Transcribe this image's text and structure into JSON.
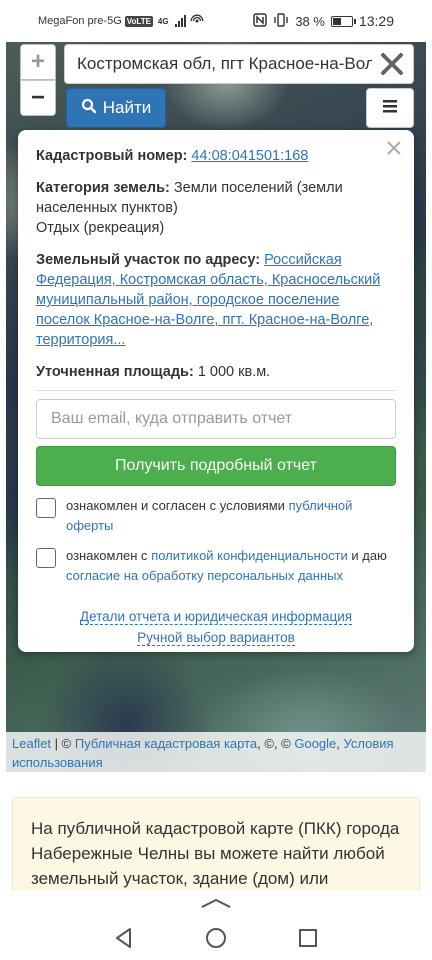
{
  "status_bar": {
    "carrier": "MegaFon pre-5G",
    "network_badge": "VoLTE",
    "network_type": "4G",
    "nfc_icon": "nfc-icon",
    "battery_percent": "38 %",
    "battery_level": 0.38,
    "time": "13:29"
  },
  "map": {
    "zoom_in_label": "+",
    "zoom_out_label": "−",
    "search": {
      "value": "Костромская обл, пгт Красное-на-Волге",
      "placeholder": ""
    },
    "find_button_label": "Найти",
    "attribution": {
      "leaflet": "Leaflet",
      "sep1": " | © ",
      "pkk": "Публичная кадастровая карта",
      "sep2": ", ©, © ",
      "google": "Google",
      "sep3": ", ",
      "terms": "Условия использования"
    }
  },
  "popup": {
    "cadastral_label": "Кадастровый номер:",
    "cadastral_number": "44:08:041501:168",
    "category_label": "Категория земель:",
    "category_value": "Земли поселений (земли населенных пунктов)",
    "usage_value": "Отдых (рекреация)",
    "address_label": "Земельный участок по адресу:",
    "address_value": "Российская Федерация, Костромская область, Красносельский муниципальный район, городское поселение поселок Красное-на-Волге, пгт. Красное-на-Волге, территория...",
    "area_label": "Уточненная площадь:",
    "area_value": "1 000 кв.м.",
    "email_placeholder": "Ваш email, куда отправить отчет",
    "report_button_label": "Получить подробный отчет",
    "check1_text": "ознакомлен и согласен с условиями",
    "check1_link": "публичной оферты",
    "check2_text_a": "ознакомлен с",
    "check2_link_a": "политикой конфиденциальности",
    "check2_text_b": "и даю",
    "check2_link_b": "согласие на обработку персональных данных",
    "link_details": "Детали отчета и юридическая информация",
    "link_manual": "Ручной выбор вариантов"
  },
  "info_text": "На публичной кадастровой карте (ПКК) города Набережные Челны вы можете найти любой земельный участок, здание (дом) или",
  "colors": {
    "primary": "#2f75b5",
    "success": "#4cae4c",
    "info_bg": "#fcf8e3"
  }
}
